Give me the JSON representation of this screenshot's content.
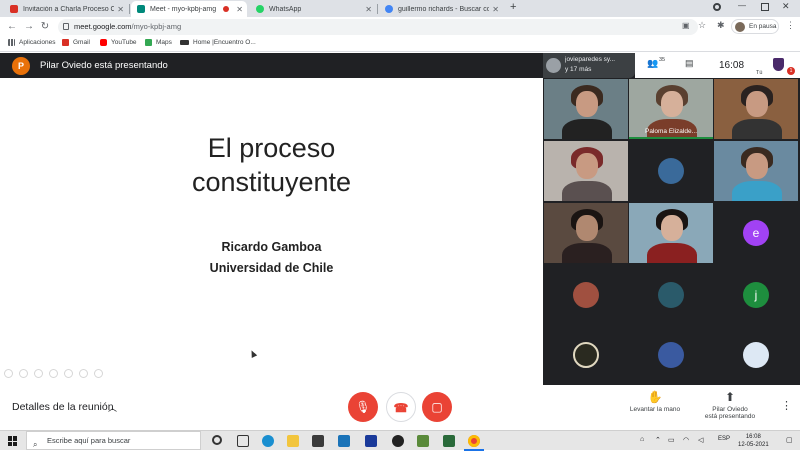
{
  "browser": {
    "tabs": [
      {
        "label": "Invitación a Charla Proceso Const",
        "favicon_color": "#d93025"
      },
      {
        "label": "Meet - myo-kpbj-amg",
        "favicon_color": "#00897b"
      },
      {
        "label": "WhatsApp",
        "favicon_color": "#25d366"
      },
      {
        "label": "guillermo richards - Buscar con G",
        "favicon_color": "#4285f4"
      }
    ],
    "new_tab": "+",
    "url_host": "meet.google.com",
    "url_path": "/myo-kpbj-amg",
    "profile_status": "En pausa",
    "bookmarks": [
      {
        "label": "Aplicaciones",
        "color": "#5f6368"
      },
      {
        "label": "Gmail",
        "color": "#d93025"
      },
      {
        "label": "YouTube",
        "color": "#ff0000"
      },
      {
        "label": "Maps",
        "color": "#34a853"
      },
      {
        "label": "Home |Encuentro O...",
        "color": "#333333"
      }
    ]
  },
  "meet": {
    "presenter_initial": "P",
    "presenter_banner": "Pilar Oviedo está presentando",
    "slide": {
      "title_line1": "El proceso",
      "title_line2": "constituyente",
      "author": "Ricardo Gamboa",
      "institution": "Universidad de Chile"
    },
    "participants_chip": {
      "line1": "jovieparedes sy...",
      "line2": "y 17 más"
    },
    "participant_count": "35",
    "clock": "16:08",
    "self_label": "Tú",
    "notification_count": "1",
    "tiles": [
      {
        "name": ""
      },
      {
        "name": "Paloma Elizalde..."
      },
      {
        "name": ""
      },
      {
        "name": ""
      },
      {
        "name": ""
      },
      {
        "name": ""
      },
      {
        "name": ""
      },
      {
        "name": ""
      },
      {
        "name": "e"
      },
      {
        "name": ""
      },
      {
        "name": ""
      },
      {
        "name": "j"
      },
      {
        "name": ""
      },
      {
        "name": ""
      },
      {
        "name": ""
      }
    ],
    "bottom": {
      "details": "Detalles de la reunión",
      "raise_hand": "Levantar la mano",
      "presenting_line1": "Pilar Oviedo",
      "presenting_line2": "está presentando"
    },
    "colors": {
      "accent_red": "#ea4335",
      "presenter_orange": "#e8710a",
      "tile_purple": "#a142f4",
      "tile_green": "#1e8e3e"
    }
  },
  "taskbar": {
    "search_placeholder": "Escribe aquí para buscar",
    "language": "ESP",
    "time": "16:08",
    "date": "12-05-2021"
  }
}
